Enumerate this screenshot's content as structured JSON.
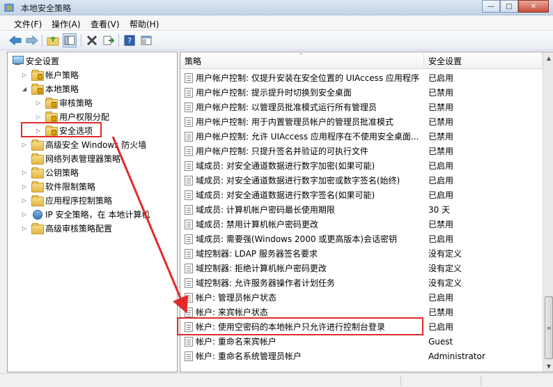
{
  "window": {
    "title": "本地安全策略"
  },
  "window_controls": {
    "minimize": "—",
    "maximize": "□",
    "close": "✕"
  },
  "menu": [
    "文件(F)",
    "操作(A)",
    "查看(V)",
    "帮助(H)"
  ],
  "tree": [
    {
      "label": "安全设置",
      "icon": "computer-icon",
      "arrow": "",
      "indent": 0
    },
    {
      "label": "帐户策略",
      "icon": "folder-lock-icon",
      "arrow": "▷",
      "indent": 1
    },
    {
      "label": "本地策略",
      "icon": "folder-lock-icon",
      "arrow": "◢",
      "indent": 1
    },
    {
      "label": "审核策略",
      "icon": "folder-lock-icon",
      "arrow": "▷",
      "indent": 2
    },
    {
      "label": "用户权限分配",
      "icon": "folder-lock-icon",
      "arrow": "▷",
      "indent": 2,
      "arrow_color": "#3c8fd6"
    },
    {
      "label": "安全选项",
      "icon": "folder-lock-icon",
      "arrow": "▷",
      "indent": 2
    },
    {
      "label": "高级安全 Windows 防火墙",
      "icon": "folder-icon",
      "arrow": "▷",
      "indent": 1
    },
    {
      "label": "网络列表管理器策略",
      "icon": "folder-icon",
      "arrow": "",
      "indent": 1
    },
    {
      "label": "公钥策略",
      "icon": "folder-icon",
      "arrow": "▷",
      "indent": 1
    },
    {
      "label": "软件限制策略",
      "icon": "folder-icon",
      "arrow": "▷",
      "indent": 1
    },
    {
      "label": "应用程序控制策略",
      "icon": "folder-icon",
      "arrow": "▷",
      "indent": 1
    },
    {
      "label": "IP 安全策略，在 本地计算机",
      "icon": "network-icon",
      "arrow": "▷",
      "indent": 1
    },
    {
      "label": "高级审核策略配置",
      "icon": "folder-icon",
      "arrow": "▷",
      "indent": 1
    }
  ],
  "list": {
    "columns": [
      "策略",
      "安全设置"
    ],
    "rows": [
      {
        "policy": "用户帐户控制: 仅提升安装在安全位置的 UIAccess 应用程序",
        "setting": "已启用"
      },
      {
        "policy": "用户帐户控制: 提示提升时切换到安全桌面",
        "setting": "已禁用"
      },
      {
        "policy": "用户帐户控制: 以管理员批准模式运行所有管理员",
        "setting": "已禁用"
      },
      {
        "policy": "用户帐户控制: 用于内置管理员帐户的管理员批准模式",
        "setting": "已禁用"
      },
      {
        "policy": "用户帐户控制: 允许 UIAccess 应用程序在不使用安全桌面...",
        "setting": "已禁用"
      },
      {
        "policy": "用户帐户控制: 只提升签名并验证的可执行文件",
        "setting": "已禁用"
      },
      {
        "policy": "域成员: 对安全通道数据进行数字加密(如果可能)",
        "setting": "已启用"
      },
      {
        "policy": "域成员: 对安全通道数据进行数字加密或数字签名(始终)",
        "setting": "已启用"
      },
      {
        "policy": "域成员: 对安全通道数据进行数字签名(如果可能)",
        "setting": "已启用"
      },
      {
        "policy": "域成员: 计算机帐户密码最长使用期限",
        "setting": "30 天"
      },
      {
        "policy": "域成员: 禁用计算机帐户密码更改",
        "setting": "已禁用"
      },
      {
        "policy": "域成员: 需要强(Windows 2000 或更高版本)会话密钥",
        "setting": "已启用"
      },
      {
        "policy": "域控制器: LDAP 服务器签名要求",
        "setting": "没有定义"
      },
      {
        "policy": "域控制器: 拒绝计算机帐户密码更改",
        "setting": "没有定义"
      },
      {
        "policy": "域控制器: 允许服务器操作者计划任务",
        "setting": "没有定义"
      },
      {
        "policy": "帐户: 管理员帐户状态",
        "setting": "已启用"
      },
      {
        "policy": "帐户: 来宾帐户状态",
        "setting": "已禁用"
      },
      {
        "policy": "帐户: 使用空密码的本地帐户只允许进行控制台登录",
        "setting": "已启用"
      },
      {
        "policy": "帐户: 重命名来宾帐户",
        "setting": "Guest"
      },
      {
        "policy": "帐户: 重命名系统管理员帐户",
        "setting": "Administrator"
      }
    ]
  },
  "colors": {
    "annotation": "#e02a2a"
  }
}
